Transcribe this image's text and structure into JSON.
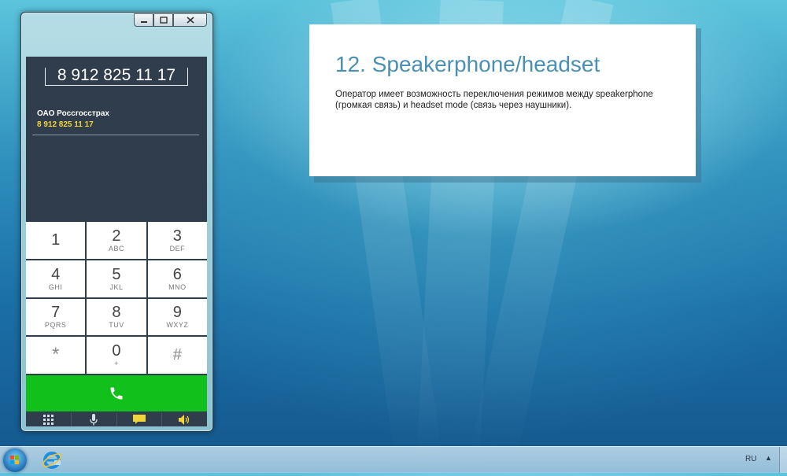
{
  "phone": {
    "dial_number": "8 912 825 11 17",
    "contact_name": "ОАО Россгосстрах",
    "contact_number": "8 912 825 11 17",
    "keys": [
      {
        "digit": "1",
        "letters": ""
      },
      {
        "digit": "2",
        "letters": "ABC"
      },
      {
        "digit": "3",
        "letters": "DEF"
      },
      {
        "digit": "4",
        "letters": "GHI"
      },
      {
        "digit": "5",
        "letters": "JKL"
      },
      {
        "digit": "6",
        "letters": "MNO"
      },
      {
        "digit": "7",
        "letters": "PQRS"
      },
      {
        "digit": "8",
        "letters": "TUV"
      },
      {
        "digit": "9",
        "letters": "WXYZ"
      },
      {
        "digit": "*",
        "letters": ""
      },
      {
        "digit": "0",
        "letters": "+"
      },
      {
        "digit": "#",
        "letters": ""
      }
    ],
    "call_icon": "phone-handset-icon",
    "bottom_icons": [
      "keypad-icon",
      "microphone-icon",
      "chat-icon",
      "speaker-icon"
    ],
    "colors": {
      "call": "#11c01a",
      "panel": "#2f3d4c",
      "contact_number": "#f1d43a"
    }
  },
  "card": {
    "title": "12. Speakerphone/headset",
    "body": "Оператор имеет возможность переключения режимов между speakerphone (громкая связь) и headset mode (связь через наушники)."
  },
  "taskbar": {
    "language": "RU",
    "tray_arrow": "▲"
  }
}
